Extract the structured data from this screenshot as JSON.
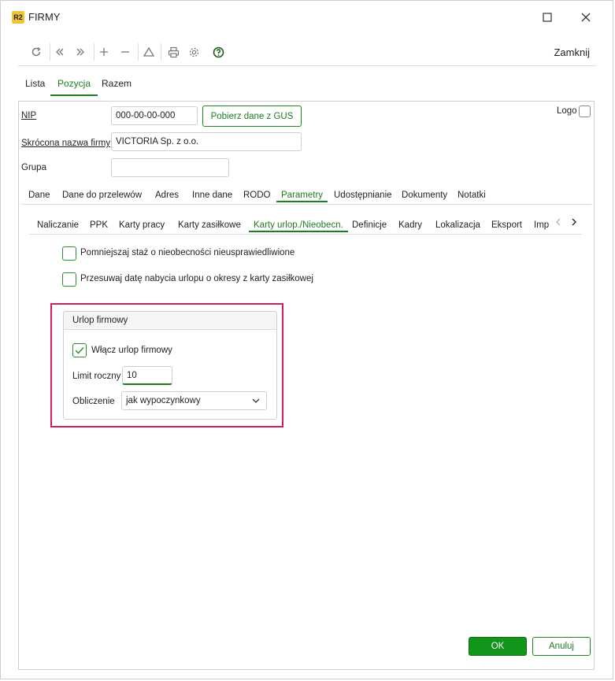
{
  "window": {
    "icon_text": "R2",
    "title": "FIRMY"
  },
  "toolbar": {
    "close_label": "Zamknij"
  },
  "main_tabs": [
    {
      "label": "Lista",
      "active": false
    },
    {
      "label": "Pozycja",
      "active": true
    },
    {
      "label": "Razem",
      "active": false
    }
  ],
  "form": {
    "nip_label": "NIP",
    "nip_value": "000-00-00-000",
    "gus_button": "Pobierz dane z GUS",
    "short_name_label": "Skrócona nazwa firmy",
    "short_name_value": "VICTORIA Sp. z o.o.",
    "group_label": "Grupa",
    "group_value": "",
    "logo_label": "Logo"
  },
  "section_tabs": [
    {
      "label": "Dane",
      "active": false
    },
    {
      "label": "Dane do przelewów",
      "active": false
    },
    {
      "label": "Adres",
      "active": false
    },
    {
      "label": "Inne dane",
      "active": false
    },
    {
      "label": "RODO",
      "active": false
    },
    {
      "label": "Parametry",
      "active": true
    },
    {
      "label": "Udostępnianie",
      "active": false
    },
    {
      "label": "Dokumenty",
      "active": false
    },
    {
      "label": "Notatki",
      "active": false
    }
  ],
  "sub_tabs": [
    {
      "label": "Naliczanie",
      "active": false
    },
    {
      "label": "PPK",
      "active": false
    },
    {
      "label": "Karty pracy",
      "active": false
    },
    {
      "label": "Karty zasiłkowe",
      "active": false
    },
    {
      "label": "Karty urlop./Nieobecn.",
      "active": true
    },
    {
      "label": "Definicje",
      "active": false
    },
    {
      "label": "Kadry",
      "active": false
    },
    {
      "label": "Lokalizacja",
      "active": false
    },
    {
      "label": "Eksport",
      "active": false
    },
    {
      "label": "Imp",
      "active": false
    }
  ],
  "options": {
    "reduce_seniority": {
      "label": "Pomniejszaj staż o nieobecności nieusprawiedliwione",
      "checked": false
    },
    "shift_vacation_date": {
      "label": "Przesuwaj datę nabycia urlopu o okresy z karty zasiłkowej",
      "checked": false
    }
  },
  "company_vacation": {
    "title": "Urlop firmowy",
    "enable_label": "Włącz urlop firmowy",
    "enabled": true,
    "annual_limit_label": "Limit roczny",
    "annual_limit_value": "10",
    "calculation_label": "Obliczenie",
    "calculation_value": "jak wypoczynkowy"
  },
  "footer": {
    "ok_label": "OK",
    "cancel_label": "Anuluj"
  },
  "colors": {
    "accent_green": "#1e7d1e",
    "ok_green": "#13941a",
    "highlight_red": "#d81b5a"
  }
}
